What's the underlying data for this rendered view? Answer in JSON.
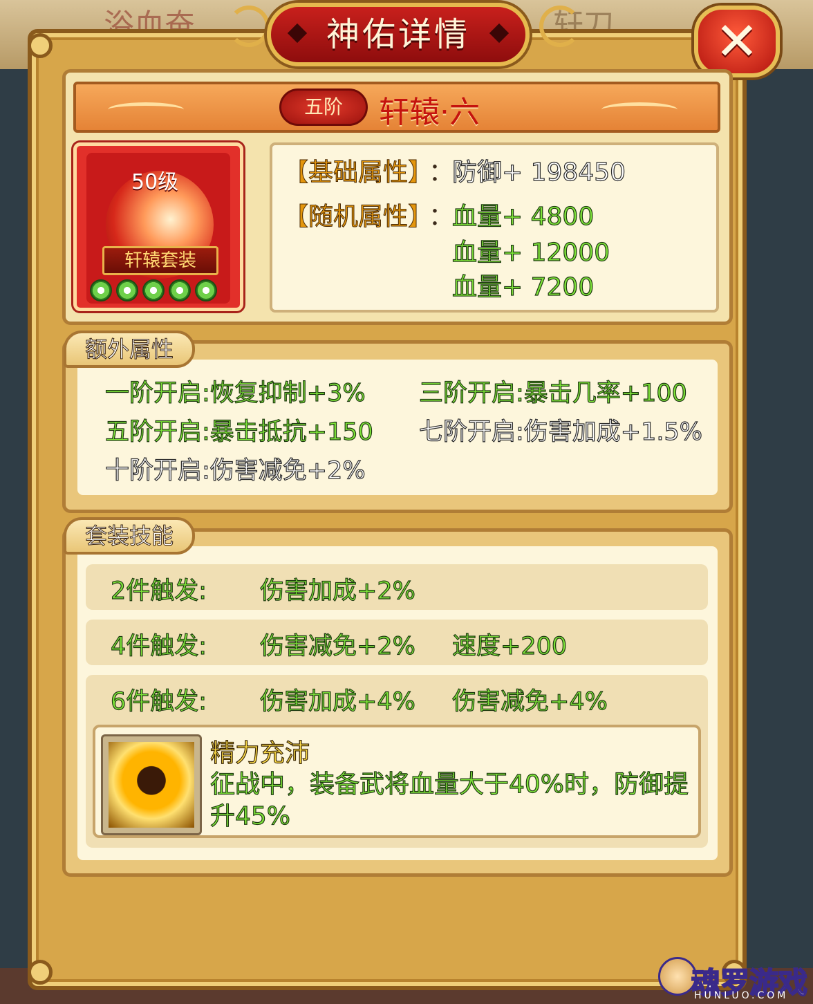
{
  "window": {
    "title": "神佑详情",
    "close_symbol": "✕"
  },
  "item": {
    "tier": "五阶",
    "name": "轩辕·六",
    "level": "50级",
    "set_name": "轩辕套装",
    "gems": 5
  },
  "attributes": {
    "base_label": "【基础属性】",
    "base_colon": "：",
    "base_value": "防御+ 198450",
    "random_label": "【随机属性】",
    "random_colon": "：",
    "random_values": [
      "血量+ 4800",
      "血量+ 12000",
      "血量+ 7200"
    ]
  },
  "extra": {
    "title": "额外属性",
    "bonuses": [
      {
        "text": "一阶开启:恢复抑制+3%",
        "active": true
      },
      {
        "text": "三阶开启:暴击几率+100",
        "active": true
      },
      {
        "text": "五阶开启:暴击抵抗+150",
        "active": true
      },
      {
        "text": "七阶开启:伤害加成+1.5%",
        "active": false
      },
      {
        "text": "十阶开启:伤害减免+2%",
        "active": false
      }
    ]
  },
  "set_skills": {
    "title": "套装技能",
    "rows": [
      {
        "trigger": "2件触发:",
        "effects": [
          "伤害加成+2%"
        ]
      },
      {
        "trigger": "4件触发:",
        "effects": [
          "伤害减免+2%",
          "速度+200"
        ]
      },
      {
        "trigger": "6件触发:",
        "effects": [
          "伤害加成+4%",
          "伤害减免+4%"
        ]
      }
    ],
    "skill": {
      "name": "精力充沛",
      "description": "征战中，装备武将血量大于40%时，防御提升45%"
    }
  },
  "background": {
    "left_text": "浴血奋",
    "right_text": "轩刀"
  },
  "watermark": {
    "text": "魂罗游戏",
    "sub": "HUNLUO.COM"
  },
  "colors": {
    "active_green": "#7fe53a",
    "frame_gold": "#d7a64a",
    "title_red": "#c8201c"
  }
}
